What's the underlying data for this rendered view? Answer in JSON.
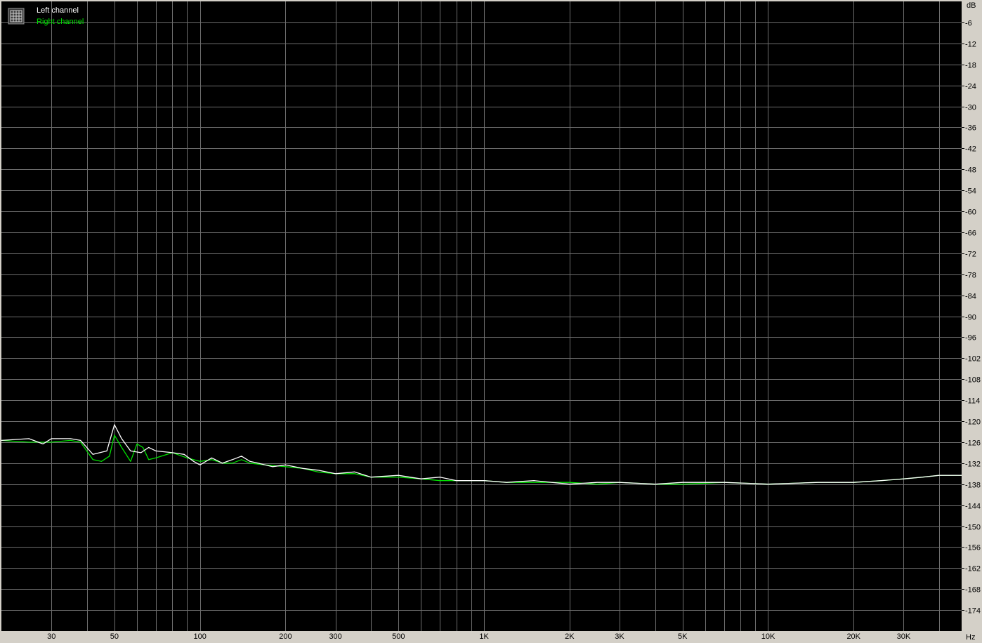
{
  "chart_data": {
    "type": "line",
    "x_scale": "log",
    "xlim": [
      20,
      48000
    ],
    "ylim": [
      -180,
      0
    ],
    "grid": true,
    "legend_position": "top-left",
    "y_unit": "dB",
    "x_unit": "Hz",
    "y_ticks": [
      -6,
      -12,
      -18,
      -24,
      -30,
      -36,
      -42,
      -48,
      -54,
      -60,
      -66,
      -72,
      -78,
      -84,
      -90,
      -96,
      -102,
      -108,
      -114,
      -120,
      -126,
      -132,
      -138,
      -144,
      -150,
      -156,
      -162,
      -168,
      -174
    ],
    "x_ticks": [
      {
        "value": 30,
        "label": "30"
      },
      {
        "value": 50,
        "label": "50"
      },
      {
        "value": 100,
        "label": "100"
      },
      {
        "value": 200,
        "label": "200"
      },
      {
        "value": 300,
        "label": "300"
      },
      {
        "value": 500,
        "label": "500"
      },
      {
        "value": 1000,
        "label": "1K"
      },
      {
        "value": 2000,
        "label": "2K"
      },
      {
        "value": 3000,
        "label": "3K"
      },
      {
        "value": 5000,
        "label": "5K"
      },
      {
        "value": 10000,
        "label": "10K"
      },
      {
        "value": 20000,
        "label": "20K"
      },
      {
        "value": 30000,
        "label": "30K"
      }
    ],
    "series": [
      {
        "name": "Left channel",
        "color": "#ffffff",
        "points": [
          [
            20,
            -125.5
          ],
          [
            25,
            -125
          ],
          [
            28,
            -126.5
          ],
          [
            30,
            -125
          ],
          [
            35,
            -125
          ],
          [
            38,
            -125.5
          ],
          [
            42,
            -129.5
          ],
          [
            47,
            -128.5
          ],
          [
            50,
            -121
          ],
          [
            53,
            -125
          ],
          [
            57,
            -128.5
          ],
          [
            62,
            -129
          ],
          [
            66,
            -127.5
          ],
          [
            70,
            -128.5
          ],
          [
            80,
            -129
          ],
          [
            88,
            -129.5
          ],
          [
            95,
            -131.5
          ],
          [
            100,
            -132.5
          ],
          [
            110,
            -130.5
          ],
          [
            120,
            -132
          ],
          [
            130,
            -131
          ],
          [
            140,
            -130
          ],
          [
            150,
            -131.5
          ],
          [
            160,
            -132
          ],
          [
            180,
            -133
          ],
          [
            200,
            -132.5
          ],
          [
            230,
            -133.5
          ],
          [
            260,
            -134
          ],
          [
            300,
            -135
          ],
          [
            350,
            -134.5
          ],
          [
            400,
            -136
          ],
          [
            500,
            -135.5
          ],
          [
            600,
            -136.5
          ],
          [
            700,
            -136
          ],
          [
            800,
            -137
          ],
          [
            1000,
            -137
          ],
          [
            1200,
            -137.5
          ],
          [
            1500,
            -137
          ],
          [
            2000,
            -138
          ],
          [
            2500,
            -137.5
          ],
          [
            3000,
            -137.5
          ],
          [
            4000,
            -138
          ],
          [
            5000,
            -137.5
          ],
          [
            7000,
            -137.5
          ],
          [
            10000,
            -138
          ],
          [
            15000,
            -137.5
          ],
          [
            20000,
            -137.5
          ],
          [
            25000,
            -137
          ],
          [
            30000,
            -136.5
          ],
          [
            35000,
            -136
          ],
          [
            40000,
            -135.5
          ],
          [
            48000,
            -135.5
          ]
        ]
      },
      {
        "name": "Right channel",
        "color": "#00e000",
        "points": [
          [
            20,
            -125.5
          ],
          [
            25,
            -126
          ],
          [
            28,
            -126
          ],
          [
            30,
            -126
          ],
          [
            35,
            -125.5
          ],
          [
            38,
            -126
          ],
          [
            42,
            -131
          ],
          [
            45,
            -131.5
          ],
          [
            48,
            -130
          ],
          [
            50,
            -124
          ],
          [
            53,
            -127.5
          ],
          [
            57,
            -131.5
          ],
          [
            60,
            -126.5
          ],
          [
            63,
            -127.5
          ],
          [
            66,
            -131
          ],
          [
            70,
            -130.5
          ],
          [
            80,
            -129
          ],
          [
            90,
            -130.5
          ],
          [
            100,
            -131.5
          ],
          [
            110,
            -131
          ],
          [
            120,
            -132
          ],
          [
            130,
            -132
          ],
          [
            140,
            -131
          ],
          [
            150,
            -132
          ],
          [
            170,
            -132.5
          ],
          [
            200,
            -133
          ],
          [
            230,
            -133.5
          ],
          [
            260,
            -134.5
          ],
          [
            300,
            -135
          ],
          [
            350,
            -135
          ],
          [
            400,
            -136
          ],
          [
            500,
            -136
          ],
          [
            600,
            -136.5
          ],
          [
            700,
            -137
          ],
          [
            800,
            -137
          ],
          [
            1000,
            -137
          ],
          [
            1200,
            -137.5
          ],
          [
            1500,
            -137.5
          ],
          [
            2000,
            -137.5
          ],
          [
            2500,
            -138
          ],
          [
            3000,
            -137.5
          ],
          [
            4000,
            -138
          ],
          [
            5000,
            -138
          ],
          [
            7000,
            -137.5
          ],
          [
            10000,
            -138
          ],
          [
            15000,
            -137.5
          ],
          [
            20000,
            -137.5
          ],
          [
            25000,
            -137
          ],
          [
            30000,
            -136.5
          ],
          [
            35000,
            -136
          ],
          [
            40000,
            -135.5
          ],
          [
            48000,
            -135.5
          ]
        ]
      }
    ]
  }
}
